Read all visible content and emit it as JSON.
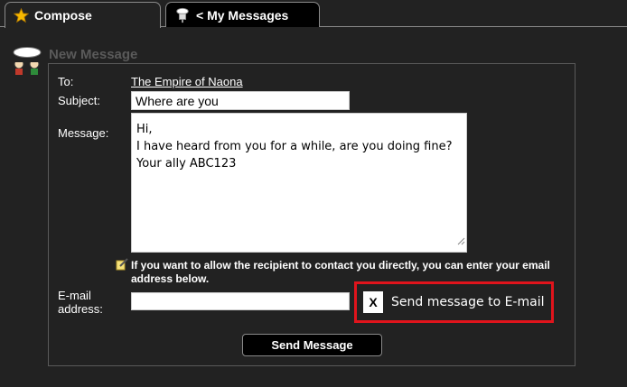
{
  "tabs": [
    {
      "label": "Compose",
      "icon": "star-icon",
      "active": true
    },
    {
      "label": "< My Messages",
      "icon": "mailbox-icon",
      "active": false
    }
  ],
  "section": {
    "title": "New Message",
    "icon": "chat-characters-icon"
  },
  "form": {
    "to_label": "To:",
    "recipient": "The Empire of Naona",
    "subject_label": "Subject:",
    "subject_value": "Where are you",
    "message_label": "Message:",
    "message_lines": [
      "Hi,",
      "I have heard from you for a while, are you doing fine?",
      "Your ally ABC123"
    ],
    "email_note": "If you want to allow the recipient to contact you directly, you can enter your email address below.",
    "email_label_line1": "E-mail",
    "email_label_line2": "address:",
    "email_value": "",
    "send_email_toggle_mark": "X",
    "send_email_label": "Send message to E-mail",
    "send_button_label": "Send Message"
  },
  "colors": {
    "background": "#222222",
    "panel_border": "#5a5a5a",
    "highlight": "#e0141c",
    "muted_title": "#5a5a5a"
  }
}
